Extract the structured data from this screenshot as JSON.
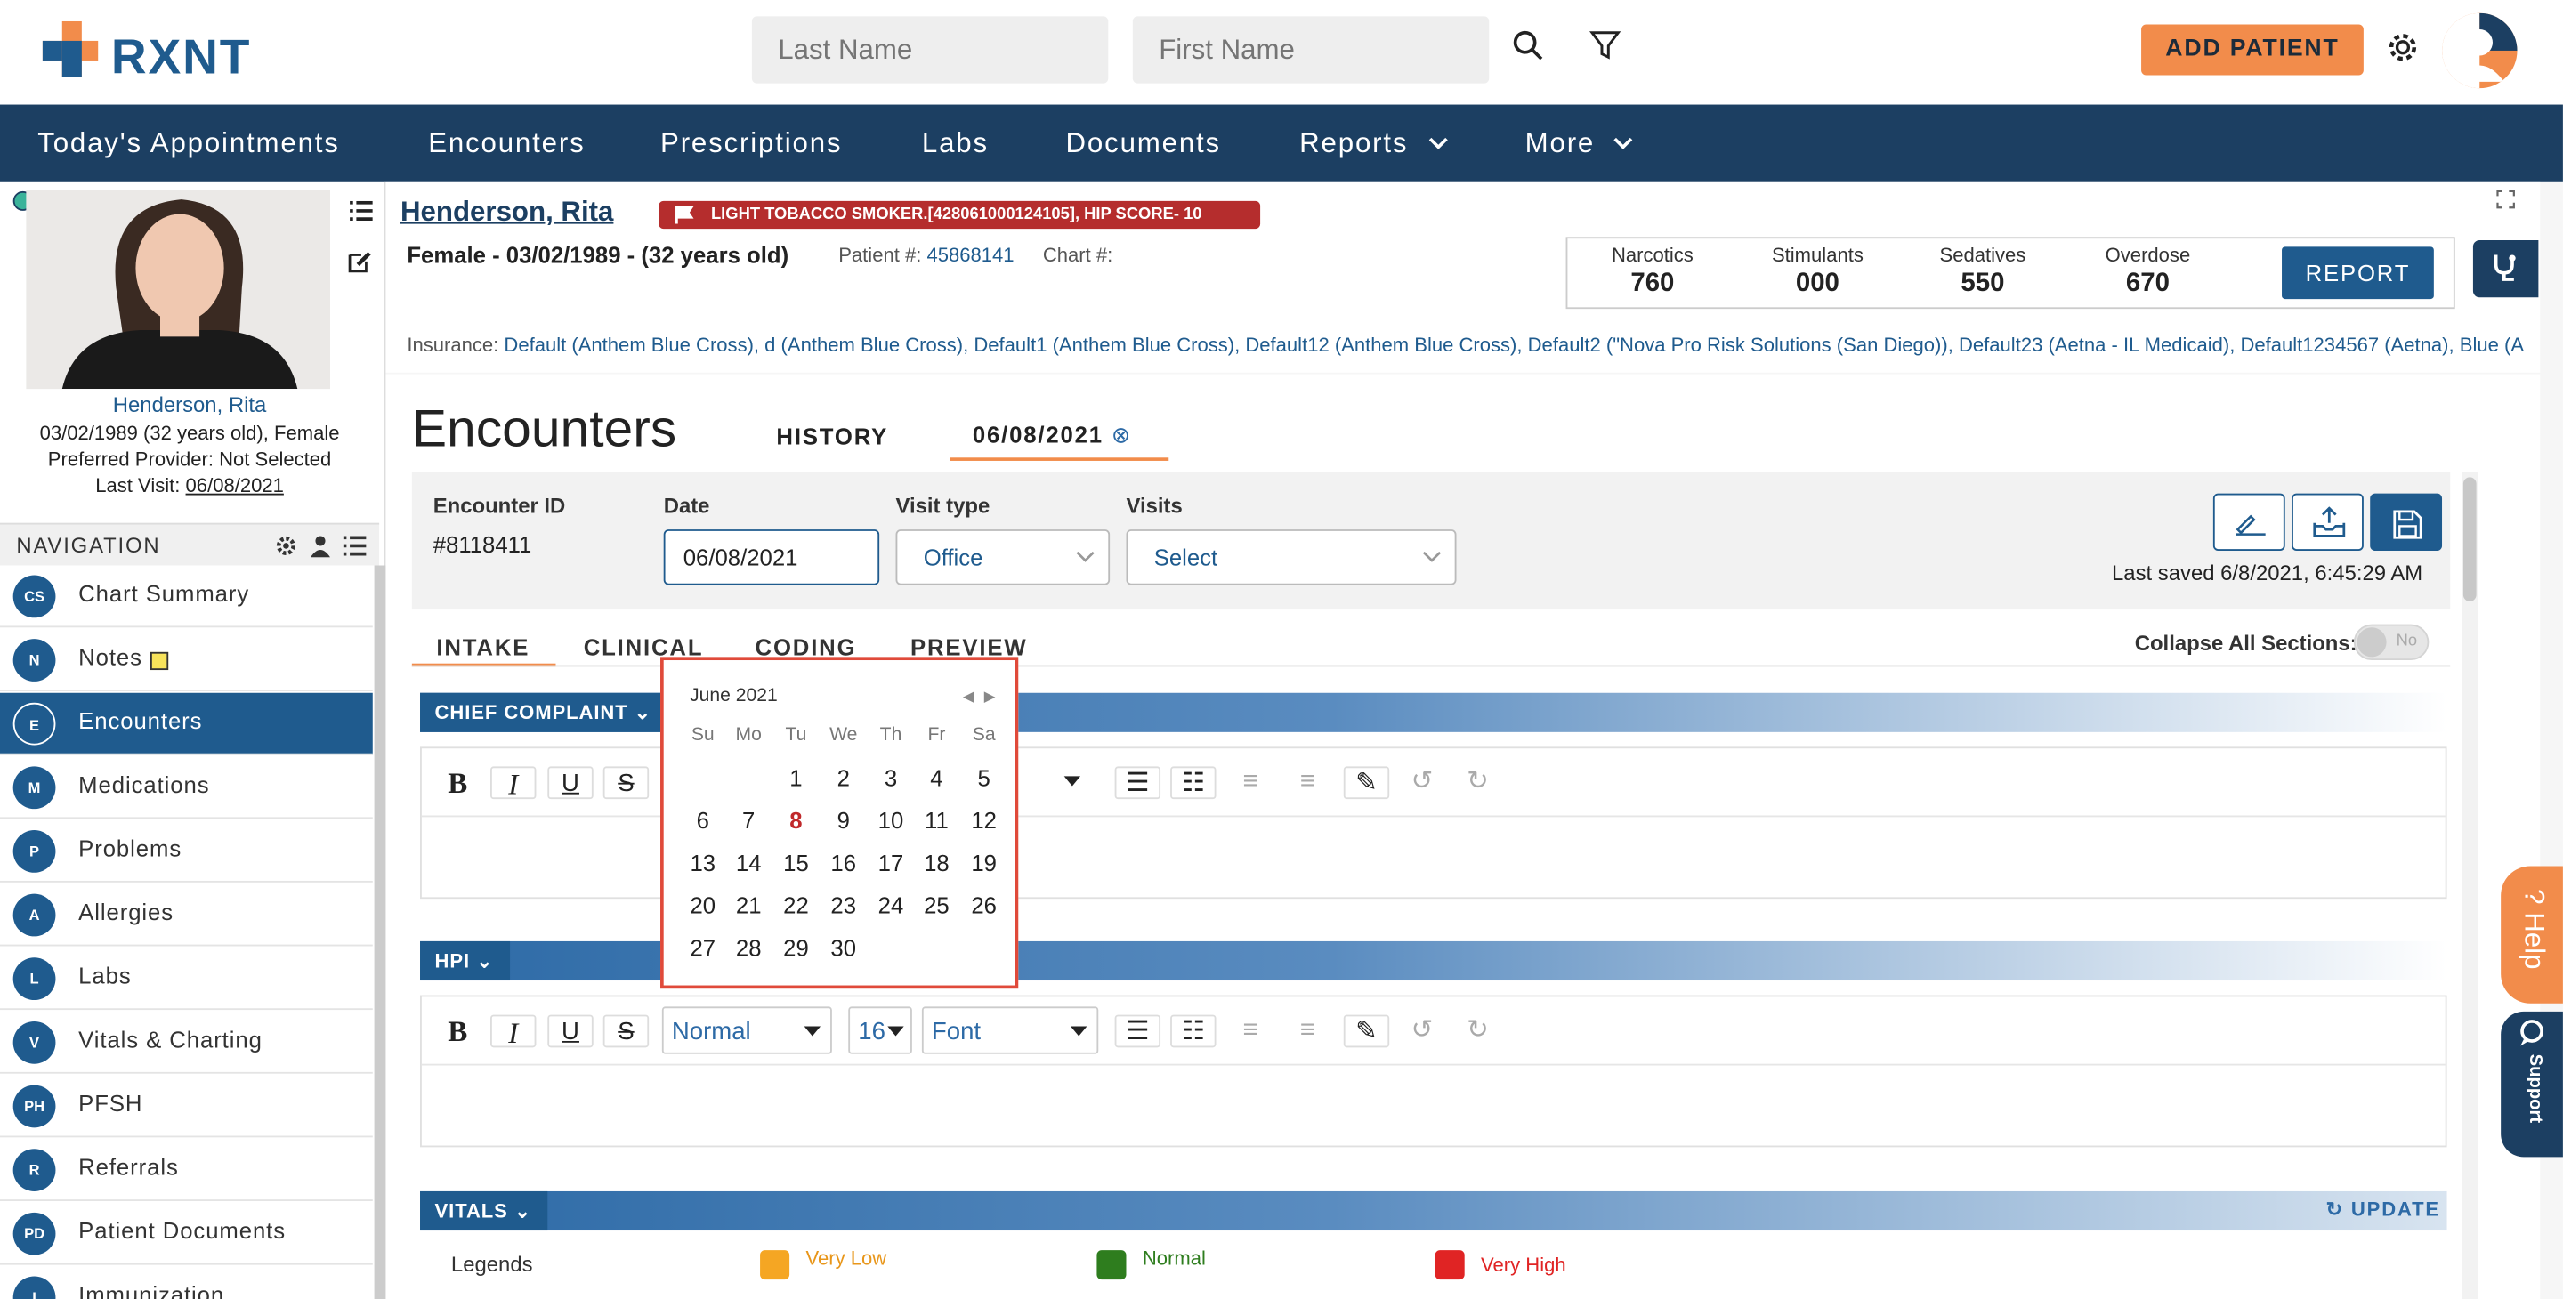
{
  "brand": {
    "name": "RXNT",
    "accent": "#f28c4b",
    "primary": "#1f5b8e",
    "nav_bg": "#1c3f62"
  },
  "search": {
    "last_name_placeholder": "Last Name",
    "first_name_placeholder": "First Name"
  },
  "header": {
    "add_patient": "ADD PATIENT"
  },
  "nav": {
    "items": [
      "Today's Appointments",
      "Encounters",
      "Prescriptions",
      "Labs",
      "Documents",
      "Reports",
      "More"
    ]
  },
  "patient": {
    "name": "Henderson, Rita",
    "flag": "LIGHT TOBACCO SMOKER.[428061000124105], HIP SCORE- 10",
    "demo": "Female - 03/02/1989 - (32 years old)",
    "patient_num_label": "Patient #:",
    "patient_num": "45868141",
    "chart_label": "Chart #:",
    "dob_line": "03/02/1989 (32 years old), Female",
    "provider_line": "Preferred Provider: Not Selected",
    "last_visit_label": "Last Visit:",
    "last_visit": "06/08/2021",
    "insurance_label": "Insurance:",
    "insurance": "Default (Anthem Blue Cross), d (Anthem Blue Cross), Default1 (Anthem Blue Cross), Default12 (Anthem Blue Cross), Default2 (\"Nova Pro Risk Solutions (San Diego)), Default23 (Aetna - IL Medicaid), Default1234567 (Aetna), Blue (A"
  },
  "pdmp": {
    "items": [
      {
        "label": "Narcotics",
        "value": "760"
      },
      {
        "label": "Stimulants",
        "value": "000"
      },
      {
        "label": "Sedatives",
        "value": "550"
      },
      {
        "label": "Overdose",
        "value": "670"
      }
    ],
    "report": "REPORT"
  },
  "sidebar": {
    "heading": "NAVIGATION",
    "items": [
      {
        "code": "CS",
        "label": "Chart Summary"
      },
      {
        "code": "N",
        "label": "Notes"
      },
      {
        "code": "E",
        "label": "Encounters"
      },
      {
        "code": "M",
        "label": "Medications"
      },
      {
        "code": "P",
        "label": "Problems"
      },
      {
        "code": "A",
        "label": "Allergies"
      },
      {
        "code": "L",
        "label": "Labs"
      },
      {
        "code": "V",
        "label": "Vitals & Charting"
      },
      {
        "code": "PH",
        "label": "PFSH"
      },
      {
        "code": "R",
        "label": "Referrals"
      },
      {
        "code": "PD",
        "label": "Patient Documents"
      },
      {
        "code": "I",
        "label": "Immunization"
      }
    ]
  },
  "encounter": {
    "title": "Encounters",
    "tab_history": "HISTORY",
    "tab_date": "06/08/2021",
    "id_label": "Encounter ID",
    "id": "#8118411",
    "date_label": "Date",
    "date": "06/08/2021",
    "visit_type_label": "Visit type",
    "visit_type": "Office",
    "visits_label": "Visits",
    "visits": "Select",
    "last_saved": "Last saved 6/8/2021, 6:45:29 AM",
    "subtabs": [
      "INTAKE",
      "CLINICAL",
      "CODING",
      "PREVIEW"
    ],
    "collapse_label": "Collapse All Sections:",
    "collapse_value": "No"
  },
  "sections": {
    "chief_complaint": "CHIEF COMPLAINT",
    "hpi": "HPI",
    "vitals": "VITALS",
    "update": "UPDATE",
    "format": "Normal",
    "size": "16",
    "font": "Font"
  },
  "legend": {
    "label": "Legends",
    "items": [
      {
        "label": "Very Low",
        "color": "#f5a623"
      },
      {
        "label": "Normal",
        "color": "#2e7d1e"
      },
      {
        "label": "Very High",
        "color": "#e02424"
      }
    ]
  },
  "calendar": {
    "month": "June 2021",
    "days": [
      "Su",
      "Mo",
      "Tu",
      "We",
      "Th",
      "Fr",
      "Sa"
    ],
    "selected": "8",
    "weeks": [
      [
        "",
        "",
        "1",
        "2",
        "3",
        "4",
        "5"
      ],
      [
        "6",
        "7",
        "8",
        "9",
        "10",
        "11",
        "12"
      ],
      [
        "13",
        "14",
        "15",
        "16",
        "17",
        "18",
        "19"
      ],
      [
        "20",
        "21",
        "22",
        "23",
        "24",
        "25",
        "26"
      ],
      [
        "27",
        "28",
        "29",
        "30",
        "",
        "",
        ""
      ]
    ]
  },
  "widgets": {
    "help": "Help",
    "support": "Support"
  }
}
